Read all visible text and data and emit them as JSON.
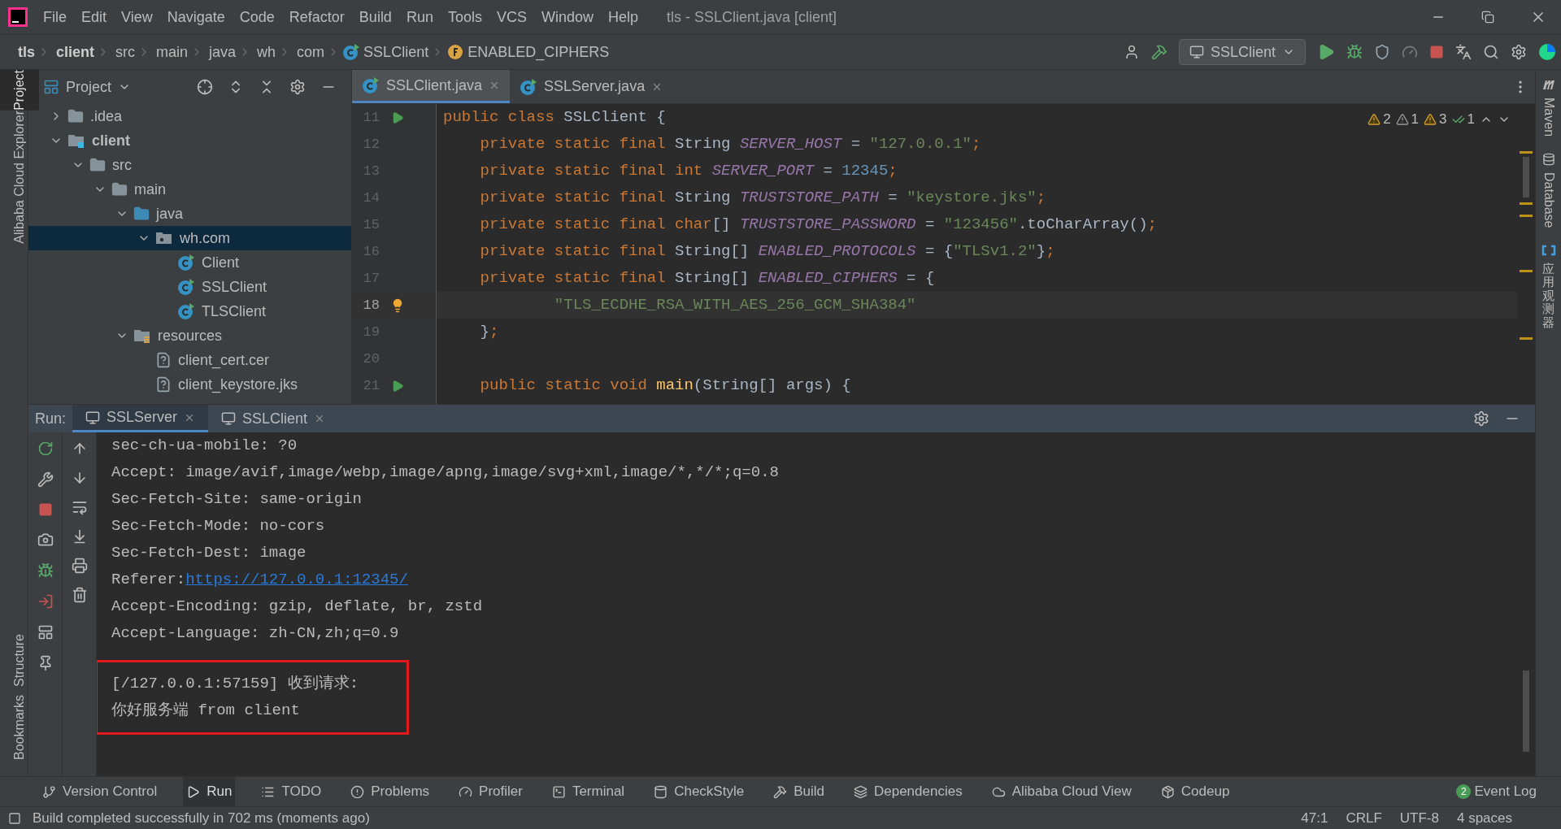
{
  "title_bar": {
    "menu": [
      "File",
      "Edit",
      "View",
      "Navigate",
      "Code",
      "Refactor",
      "Build",
      "Run",
      "Tools",
      "VCS",
      "Window",
      "Help"
    ],
    "title": "tls - SSLClient.java [client]"
  },
  "nav_bar": {
    "breadcrumbs": [
      {
        "text": "tls",
        "kind": "project"
      },
      {
        "text": "client",
        "kind": "module"
      },
      {
        "text": "src",
        "kind": "plain"
      },
      {
        "text": "main",
        "kind": "plain"
      },
      {
        "text": "java",
        "kind": "plain"
      },
      {
        "text": "wh",
        "kind": "plain"
      },
      {
        "text": "com",
        "kind": "plain"
      },
      {
        "text": "SSLClient",
        "kind": "class"
      },
      {
        "text": "ENABLED_CIPHERS",
        "kind": "field"
      }
    ],
    "run_config": "SSLClient"
  },
  "left_stripe": {
    "top": [
      {
        "label": "Project",
        "selected": true
      },
      {
        "label": "Alibaba Cloud Explorer",
        "selected": false
      }
    ],
    "bottom": [
      {
        "label": "Structure",
        "selected": false
      },
      {
        "label": "Bookmarks",
        "selected": false
      }
    ]
  },
  "right_stripe": [
    "Maven",
    "Database",
    "应用观测器"
  ],
  "project_panel": {
    "title": "Project",
    "tree": [
      {
        "name": ".idea",
        "kind": "folder",
        "expanded": false,
        "selected": false
      },
      {
        "name": "client",
        "kind": "module",
        "expanded": true,
        "selected": false,
        "children": [
          {
            "name": "src",
            "kind": "folder",
            "expanded": true,
            "selected": false,
            "children": [
              {
                "name": "main",
                "kind": "folder",
                "expanded": true,
                "selected": false,
                "children": [
                  {
                    "name": "java",
                    "kind": "source",
                    "expanded": true,
                    "selected": false,
                    "children": [
                      {
                        "name": "wh.com",
                        "kind": "package",
                        "expanded": true,
                        "selected": true,
                        "children": [
                          {
                            "name": "Client",
                            "kind": "class",
                            "selected": false
                          },
                          {
                            "name": "SSLClient",
                            "kind": "class",
                            "selected": false
                          },
                          {
                            "name": "TLSClient",
                            "kind": "class",
                            "selected": false
                          }
                        ]
                      }
                    ]
                  },
                  {
                    "name": "resources",
                    "kind": "resources",
                    "expanded": true,
                    "selected": false,
                    "children": [
                      {
                        "name": "client_cert.cer",
                        "kind": "file",
                        "selected": false
                      },
                      {
                        "name": "client_keystore.jks",
                        "kind": "file",
                        "selected": false
                      }
                    ]
                  }
                ]
              }
            ]
          }
        ]
      }
    ]
  },
  "editor": {
    "tabs": [
      {
        "label": "SSLClient.java",
        "selected": true
      },
      {
        "label": "SSLServer.java",
        "selected": false
      }
    ],
    "inspections": [
      {
        "count": "2",
        "kind": "warning"
      },
      {
        "count": "1",
        "kind": "weak"
      },
      {
        "count": "3",
        "kind": "warning"
      },
      {
        "count": "1",
        "kind": "ok"
      }
    ],
    "lines": [
      {
        "number": "11",
        "run_marker": true,
        "current": false,
        "tokens": [
          {
            "text": "public class ",
            "kind": "keyword"
          },
          {
            "text": "SSLClient {",
            "kind": "plain"
          }
        ]
      },
      {
        "number": "12",
        "current": false,
        "tokens": [
          {
            "text": "    private static final ",
            "kind": "keyword"
          },
          {
            "text": "String ",
            "kind": "plain"
          },
          {
            "text": "SERVER_HOST",
            "kind": "constant"
          },
          {
            "text": " = ",
            "kind": "plain"
          },
          {
            "text": "\"127.0.0.1\"",
            "kind": "string"
          },
          {
            "text": ";",
            "kind": "keyword"
          }
        ]
      },
      {
        "number": "13",
        "current": false,
        "tokens": [
          {
            "text": "    private static final int ",
            "kind": "keyword"
          },
          {
            "text": "SERVER_PORT",
            "kind": "constant"
          },
          {
            "text": " = ",
            "kind": "plain"
          },
          {
            "text": "12345",
            "kind": "number"
          },
          {
            "text": ";",
            "kind": "keyword"
          }
        ]
      },
      {
        "number": "14",
        "current": false,
        "tokens": [
          {
            "text": "    private static final ",
            "kind": "keyword"
          },
          {
            "text": "String ",
            "kind": "plain"
          },
          {
            "text": "TRUSTSTORE_PATH",
            "kind": "constant"
          },
          {
            "text": " = ",
            "kind": "plain"
          },
          {
            "text": "\"keystore.jks\"",
            "kind": "string"
          },
          {
            "text": ";",
            "kind": "keyword"
          }
        ]
      },
      {
        "number": "15",
        "current": false,
        "tokens": [
          {
            "text": "    private static final char",
            "kind": "keyword"
          },
          {
            "text": "[] ",
            "kind": "plain"
          },
          {
            "text": "TRUSTSTORE_PASSWORD",
            "kind": "constant"
          },
          {
            "text": " = ",
            "kind": "plain"
          },
          {
            "text": "\"123456\"",
            "kind": "string"
          },
          {
            "text": ".toCharArray()",
            "kind": "plain"
          },
          {
            "text": ";",
            "kind": "keyword"
          }
        ]
      },
      {
        "number": "16",
        "current": false,
        "tokens": [
          {
            "text": "    private static final ",
            "kind": "keyword"
          },
          {
            "text": "String[] ",
            "kind": "plain"
          },
          {
            "text": "ENABLED_PROTOCOLS",
            "kind": "constant"
          },
          {
            "text": " = {",
            "kind": "plain"
          },
          {
            "text": "\"TLSv1.2\"",
            "kind": "string"
          },
          {
            "text": "}",
            "kind": "plain"
          },
          {
            "text": ";",
            "kind": "keyword"
          }
        ]
      },
      {
        "number": "17",
        "current": false,
        "tokens": [
          {
            "text": "    private static final ",
            "kind": "keyword"
          },
          {
            "text": "String[] ",
            "kind": "plain"
          },
          {
            "text": "ENABLED_CIPHERS",
            "kind": "constant"
          },
          {
            "text": " = {",
            "kind": "plain"
          }
        ]
      },
      {
        "number": "18",
        "intention_bulb": true,
        "current": true,
        "tokens": [
          {
            "text": "            \"TLS_ECDHE_RSA_WITH_AES_256_GCM_SHA384\"",
            "kind": "string"
          }
        ]
      },
      {
        "number": "19",
        "current": false,
        "tokens": [
          {
            "text": "    }",
            "kind": "plain"
          },
          {
            "text": ";",
            "kind": "keyword"
          }
        ]
      },
      {
        "number": "20",
        "current": false
      },
      {
        "number": "21",
        "run_marker": true,
        "current": false,
        "tokens": [
          {
            "text": "    public static void ",
            "kind": "keyword"
          },
          {
            "text": "main",
            "kind": "method"
          },
          {
            "text": "(String[] args) {",
            "kind": "plain"
          }
        ]
      }
    ]
  },
  "run_panel": {
    "label": "Run:",
    "tabs": [
      {
        "label": "SSLServer",
        "selected": true
      },
      {
        "label": "SSLClient",
        "selected": false
      }
    ],
    "output": [
      {
        "tokens": [
          {
            "text": "sec-ch-ua-mobile: ?0",
            "kind": "plain"
          }
        ]
      },
      {
        "tokens": [
          {
            "text": "Accept: image/avif,image/webp,image/apng,image/svg+xml,image/*,*/*;q=0.8",
            "kind": "plain"
          }
        ]
      },
      {
        "tokens": [
          {
            "text": "Sec-Fetch-Site: same-origin",
            "kind": "plain"
          }
        ]
      },
      {
        "tokens": [
          {
            "text": "Sec-Fetch-Mode: no-cors",
            "kind": "plain"
          }
        ]
      },
      {
        "tokens": [
          {
            "text": "Sec-Fetch-Dest: image",
            "kind": "plain"
          }
        ]
      },
      {
        "tokens": [
          {
            "text": "Referer: ",
            "kind": "plain"
          },
          {
            "text": "https://127.0.0.1:12345/",
            "kind": "link"
          }
        ]
      },
      {
        "tokens": [
          {
            "text": "Accept-Encoding: gzip, deflate, br, zstd",
            "kind": "plain"
          }
        ]
      },
      {
        "tokens": [
          {
            "text": "Accept-Language: zh-CN,zh;q=0.9",
            "kind": "plain"
          }
        ]
      }
    ],
    "highlighted_output": [
      "[/127.0.0.1:57159] 收到请求:",
      "你好服务端 from client"
    ]
  },
  "tool_windows": [
    {
      "label": "Version Control",
      "selected": false
    },
    {
      "label": "Run",
      "selected": true
    },
    {
      "label": "TODO",
      "selected": false
    },
    {
      "label": "Problems",
      "selected": false
    },
    {
      "label": "Profiler",
      "selected": false
    },
    {
      "label": "Terminal",
      "selected": false
    },
    {
      "label": "CheckStyle",
      "selected": false
    },
    {
      "label": "Build",
      "selected": false
    },
    {
      "label": "Dependencies",
      "selected": false
    },
    {
      "label": "Alibaba Cloud View",
      "selected": false
    },
    {
      "label": "Codeup",
      "selected": false
    }
  ],
  "event_log": {
    "label": "Event Log",
    "badge": "2"
  },
  "status_bar": {
    "message": "Build completed successfully in 702 ms (moments ago)",
    "items": [
      "47:1",
      "CRLF",
      "UTF-8",
      "4 spaces"
    ]
  }
}
